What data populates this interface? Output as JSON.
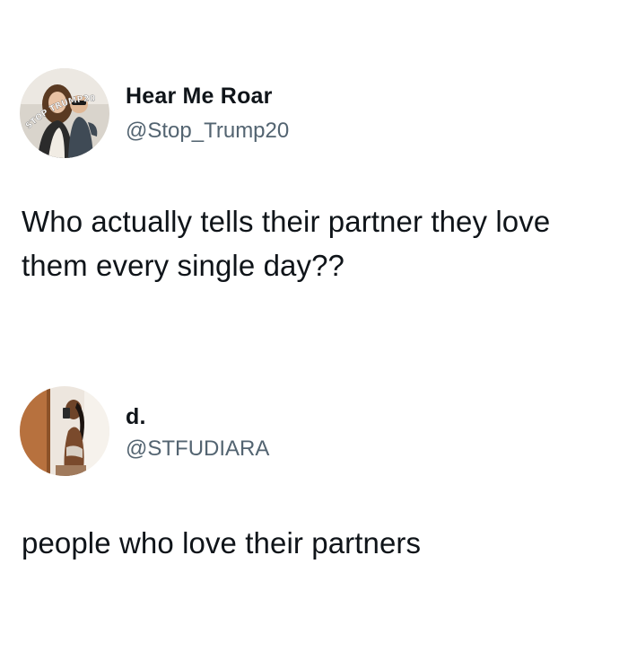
{
  "tweets": [
    {
      "display_name": "Hear Me Roar",
      "handle": "@Stop_Trump20",
      "text": "Who actually tells their partner they love them every single day??",
      "avatar_badge": "STOP TRUMP20",
      "avatar_icon": "profile-photo-woman-and-child"
    },
    {
      "display_name": "d.",
      "handle": "@STFUDIARA",
      "text": "people who love their partners",
      "avatar_icon": "profile-photo-mirror-selfie"
    }
  ],
  "colors": {
    "background": "#ffffff",
    "primary_text": "#0f1419",
    "secondary_text": "#536471"
  }
}
